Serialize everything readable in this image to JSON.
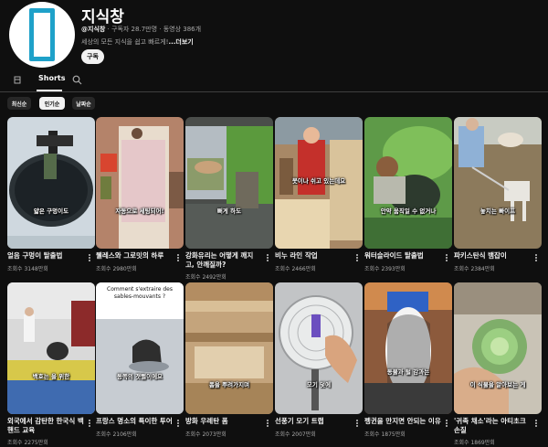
{
  "channel": {
    "name": "지식창",
    "handle": "@지식창",
    "subscribers": "구독자 28.7만명",
    "video_count": "동영상 386개",
    "separator": " · ",
    "description": "세상의 모든 지식을 쉽고 빠르게!",
    "more_label": "...더보기",
    "subscribe_label": "구독",
    "avatar_color": "#1fa1c9"
  },
  "tabs": {
    "home_icon": "home-icon",
    "shorts_label": "Shorts",
    "search_icon": "search-icon"
  },
  "filters": [
    {
      "label": "최신순",
      "selected": false
    },
    {
      "label": "인기순",
      "selected": true
    },
    {
      "label": "날짜순",
      "selected": false
    }
  ],
  "videos": [
    {
      "title": "얼음 구멍이 탈출법",
      "title2": "",
      "views": "조회수 3148만회",
      "caption": "얇은 구멍이도"
    },
    {
      "title": "웰레스와 그로밋의 하루",
      "title2": "",
      "views": "조회수 2980만회",
      "caption": "자동으로 세팅되어!"
    },
    {
      "title": "강화유리는 어떻게 깨지",
      "title2": "고, 안깨질까?",
      "views": "조회수 2492만회",
      "caption": "뻐게 하도"
    },
    {
      "title": "비누 라인 작업",
      "title2": "",
      "views": "조회수 2466만회",
      "caption": "못이나 쉬고 있는데요"
    },
    {
      "title": "워터슬라이드 탈출법",
      "title2": "",
      "views": "조회수 2393만회",
      "caption": "안약 움직일 수 없거나"
    },
    {
      "title": "파키스탄식 뱀잡이",
      "title2": "",
      "views": "조회수 2384만회",
      "caption": "놓치는 빠이프"
    },
    {
      "title": "외국에서 감탄한 한국식 백",
      "title2": "핸드 교육",
      "views": "조회수 2275만회",
      "caption": "백호는 을 위한"
    },
    {
      "title": "프랑스 명소의 특이한 투어",
      "title2": "",
      "views": "조회수 2106만회",
      "caption": "동쪽의 갯뻘이에요",
      "overlay": "Comment s'extraire des sables-mouvants ?"
    },
    {
      "title": "방화 우레탄 폼",
      "title2": "",
      "views": "조회수 2073만회",
      "caption": "폼을 뿌려가지며"
    },
    {
      "title": "선풍기 모기 트랩",
      "title2": "",
      "views": "조회수 2007만회",
      "caption": "모기 덫에"
    },
    {
      "title": "펭귄을 만지면 안되는 이유",
      "title2": "",
      "views": "조회수 1875만회",
      "caption": "동물과 털 감과는"
    },
    {
      "title": "'귀족 채소'라는 아티초크",
      "title2": "손질",
      "views": "조회수 1869만회",
      "caption": "이 식물을 알아보는 게"
    }
  ]
}
